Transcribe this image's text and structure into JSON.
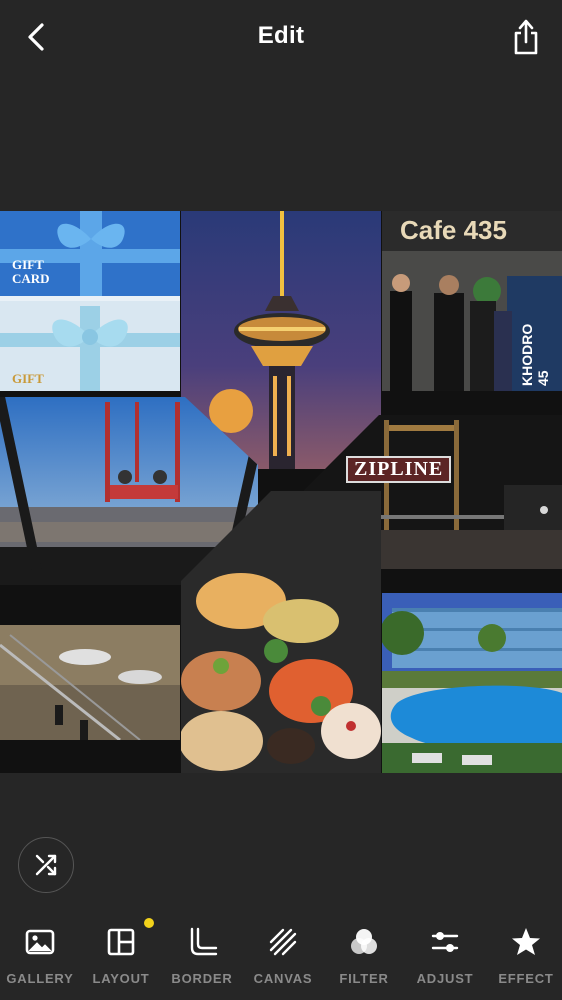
{
  "header": {
    "title": "Edit"
  },
  "icons": {
    "back": "chevron-left-icon",
    "share": "share-icon",
    "shuffle": "shuffle-icon"
  },
  "photos": {
    "gift": {
      "line1": "GIFT",
      "line2": "CARD",
      "line3": "GIFT"
    },
    "cafe": {
      "sign": "Cafe 435",
      "banner": "KHODRO 45"
    },
    "zipline": {
      "sign": "ZIPLINE"
    }
  },
  "toolbar": {
    "items": [
      {
        "label": "GALLERY",
        "icon": "image-icon",
        "badge": false
      },
      {
        "label": "LAYOUT",
        "icon": "layout-icon",
        "badge": true
      },
      {
        "label": "BORDER",
        "icon": "border-icon",
        "badge": false
      },
      {
        "label": "CANVAS",
        "icon": "canvas-icon",
        "badge": false
      },
      {
        "label": "FILTER",
        "icon": "filter-icon",
        "badge": false
      },
      {
        "label": "ADJUST",
        "icon": "adjust-icon",
        "badge": false
      },
      {
        "label": "EFFECT",
        "icon": "star-icon",
        "badge": false
      }
    ]
  },
  "colors": {
    "background": "#262626",
    "label": "#8a8a8a",
    "badge": "#f2d21b"
  }
}
